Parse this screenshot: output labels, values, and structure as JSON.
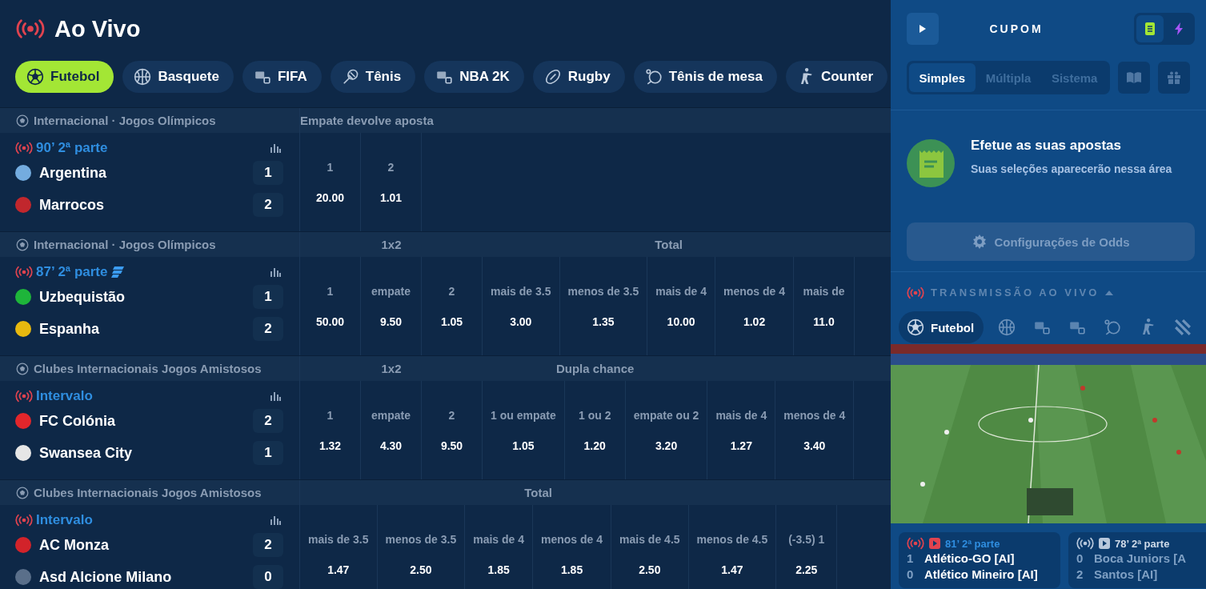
{
  "header": {
    "title": "Ao Vivo"
  },
  "sports": [
    {
      "kind": "ball",
      "label": "Futebol",
      "selected": true
    },
    {
      "kind": "basketball",
      "label": "Basquete",
      "selected": false
    },
    {
      "kind": "fifa",
      "label": "FIFA",
      "selected": false
    },
    {
      "kind": "tennis",
      "label": "Tênis",
      "selected": false
    },
    {
      "kind": "nba",
      "label": "NBA 2K",
      "selected": false
    },
    {
      "kind": "rugby",
      "label": "Rugby",
      "selected": false
    },
    {
      "kind": "pingpong",
      "label": "Tênis de mesa",
      "selected": false
    },
    {
      "kind": "shooter",
      "label": "Counter",
      "selected": false
    }
  ],
  "events": [
    {
      "league": "Internacional · Jogos Olímpicos",
      "status": "90’ 2ª parte",
      "streaming": false,
      "teams": [
        {
          "name": "Argentina",
          "score": "1",
          "color": "#74acdf"
        },
        {
          "name": "Marrocos",
          "score": "2",
          "color": "#c1272d"
        }
      ],
      "markets": [
        {
          "title": "Empate devolve aposta",
          "outcomes": [
            {
              "label": "1",
              "odd": "20.00"
            },
            {
              "label": "2",
              "odd": "1.01"
            }
          ]
        }
      ]
    },
    {
      "league": "Internacional · Jogos Olímpicos",
      "status": "87’ 2ª parte",
      "streaming": true,
      "teams": [
        {
          "name": "Uzbequistão",
          "score": "1",
          "color": "#1eb53a"
        },
        {
          "name": "Espanha",
          "score": "2",
          "color": "#e8b90f"
        }
      ],
      "markets": [
        {
          "title": "1x2",
          "outcomes": [
            {
              "label": "1",
              "odd": "50.00"
            },
            {
              "label": "empate",
              "odd": "9.50"
            },
            {
              "label": "2",
              "odd": "1.05"
            }
          ]
        },
        {
          "title": "Total",
          "outcomes": [
            {
              "label": "mais de 3.5",
              "odd": "3.00"
            },
            {
              "label": "menos de 3.5",
              "odd": "1.35"
            },
            {
              "label": "mais de 4",
              "odd": "10.00"
            },
            {
              "label": "menos de 4",
              "odd": "1.02"
            },
            {
              "label": "mais de",
              "odd": "11.0"
            }
          ]
        }
      ]
    },
    {
      "league": "Clubes Internacionais Jogos Amistosos",
      "status": "Intervalo",
      "streaming": false,
      "teams": [
        {
          "name": "FC Colónia",
          "score": "2",
          "color": "#e2262b"
        },
        {
          "name": "Swansea City",
          "score": "1",
          "color": "#e6e6e6"
        }
      ],
      "markets": [
        {
          "title": "1x2",
          "outcomes": [
            {
              "label": "1",
              "odd": "1.32"
            },
            {
              "label": "empate",
              "odd": "4.30"
            },
            {
              "label": "2",
              "odd": "9.50"
            }
          ]
        },
        {
          "title": "Dupla chance",
          "outcomes": [
            {
              "label": "1 ou empate",
              "odd": "1.05"
            },
            {
              "label": "1 ou 2",
              "odd": "1.20"
            },
            {
              "label": "empate ou 2",
              "odd": "3.20"
            }
          ]
        },
        {
          "outcomes": [
            {
              "label": "mais de 4",
              "odd": "1.27"
            },
            {
              "label": "menos de 4",
              "odd": "3.40"
            }
          ]
        }
      ]
    },
    {
      "league": "Clubes Internacionais Jogos Amistosos",
      "status": "Intervalo",
      "streaming": false,
      "teams": [
        {
          "name": "AC Monza",
          "score": "2",
          "color": "#d2232a"
        },
        {
          "name": "Asd Alcione Milano",
          "score": "0",
          "color": "#5a6f8a"
        }
      ],
      "markets": [
        {
          "title": "Total",
          "outcomes": [
            {
              "label": "mais de 3.5",
              "odd": "1.47"
            },
            {
              "label": "menos de 3.5",
              "odd": "2.50"
            },
            {
              "label": "mais de 4",
              "odd": "1.85"
            },
            {
              "label": "menos de 4",
              "odd": "1.85"
            },
            {
              "label": "mais de 4.5",
              "odd": "2.50"
            },
            {
              "label": "menos de 4.5",
              "odd": "1.47"
            }
          ]
        },
        {
          "outcomes": [
            {
              "label": "(-3.5) 1",
              "odd": "2.25"
            }
          ]
        }
      ]
    }
  ],
  "coupon": {
    "title": "CUPOM",
    "modes": [
      {
        "kind": "list",
        "selected": true
      },
      {
        "kind": "bolt",
        "selected": false
      }
    ],
    "tabs": [
      {
        "label": "Simples",
        "selected": true
      },
      {
        "label": "Múltipla",
        "selected": false
      },
      {
        "label": "Sistema",
        "selected": false
      }
    ],
    "empty": {
      "title": "Efetue as suas apostas",
      "text": "Suas seleções aparecerão nessa área"
    },
    "odds_settings": {
      "label": "Configurações de Odds",
      "disabled": true
    }
  },
  "stream": {
    "title": "TRANSMISSÃO AO VIVO",
    "expanded": true,
    "sports": [
      {
        "kind": "ball",
        "label": "Futebol",
        "selected": true
      },
      {
        "kind": "basketball",
        "selected": false
      },
      {
        "kind": "fifa",
        "selected": false
      },
      {
        "kind": "nba",
        "selected": false
      },
      {
        "kind": "pingpong",
        "selected": false
      },
      {
        "kind": "shooter",
        "selected": false
      },
      {
        "kind": "esport",
        "selected": false
      }
    ],
    "matches": [
      {
        "status": "81’ 2ª parte",
        "selected": true,
        "teams": [
          {
            "score": "1",
            "name": "Atlético-GO [AI]"
          },
          {
            "score": "0",
            "name": "Atlético Mineiro [AI]"
          }
        ]
      },
      {
        "status": "78’ 2ª parte",
        "selected": false,
        "teams": [
          {
            "score": "0",
            "name": "Boca Juniors [A"
          },
          {
            "score": "2",
            "name": "Santos [AI]"
          }
        ]
      }
    ]
  }
}
